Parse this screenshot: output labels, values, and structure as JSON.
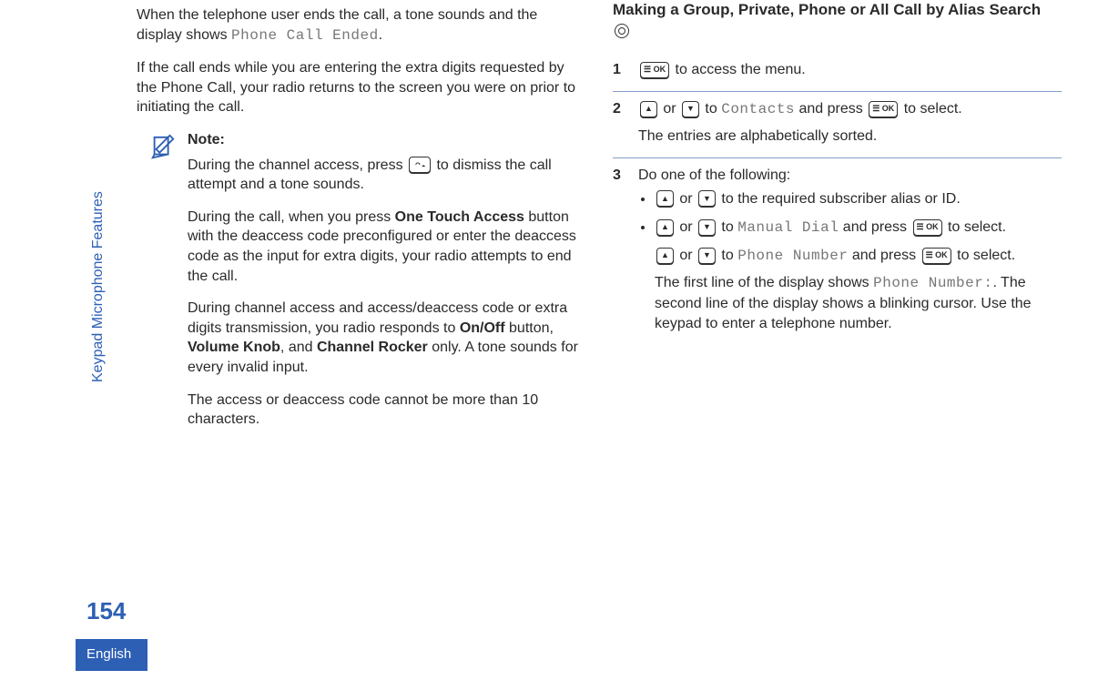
{
  "sidebar": {
    "section": "Keypad Microphone Features",
    "pageNumber": "154",
    "language": "English"
  },
  "left": {
    "p1a": "When the telephone user ends the call, a tone sounds and the display shows ",
    "p1b": "Phone Call Ended",
    "p1c": ".",
    "p2": "If the call ends while you are entering the extra digits requested by the Phone Call, your radio returns to the screen you were on prior to initiating the call.",
    "note": {
      "title": "Note:",
      "n1a": "During the channel access, press ",
      "n1b": " to dismiss the call attempt and a tone sounds.",
      "n2a": "During the call, when you press ",
      "n2b": "One Touch Access",
      "n2c": " button with the deaccess code preconfigured or enter the deaccess code as the input for extra digits, your radio attempts to end the call.",
      "n3a": "During channel access and access/deaccess code or extra digits transmission, you radio responds to ",
      "n3b": "On/Off",
      "n3c": " button, ",
      "n3d": "Volume Knob",
      "n3e": ", and ",
      "n3f": "Channel Rocker",
      "n3g": " only. A tone sounds for every invalid input.",
      "n4": "The access or deaccess code cannot be more than 10 characters."
    }
  },
  "right": {
    "heading": "Making a Group, Private, Phone or All Call by Alias Search ",
    "step1": {
      "num": "1",
      "a": " to access the menu."
    },
    "step2": {
      "num": "2",
      "a": " or ",
      "b": " to ",
      "c": "Contacts",
      "d": " and press ",
      "e": " to select.",
      "f": "The entries are alphabetically sorted."
    },
    "step3": {
      "num": "3",
      "intro": "Do one of the following:",
      "b1a": " or ",
      "b1b": " to the required subscriber alias or ID.",
      "b2a": " or ",
      "b2b": " to ",
      "b2c": "Manual Dial",
      "b2d": " and press ",
      "b2e": " to select.",
      "b3a": " or ",
      "b3b": " to ",
      "b3c": "Phone Number",
      "b3d": " and press ",
      "b3e": " to select.",
      "b4a": "The first line of the display shows ",
      "b4b": "Phone Number:",
      "b4c": ". The second line of the display shows a blinking cursor. Use the keypad to enter a telephone number."
    }
  },
  "keys": {
    "ok": "☰ OK",
    "arrowUp": "▲",
    "arrowDown": "▼"
  }
}
